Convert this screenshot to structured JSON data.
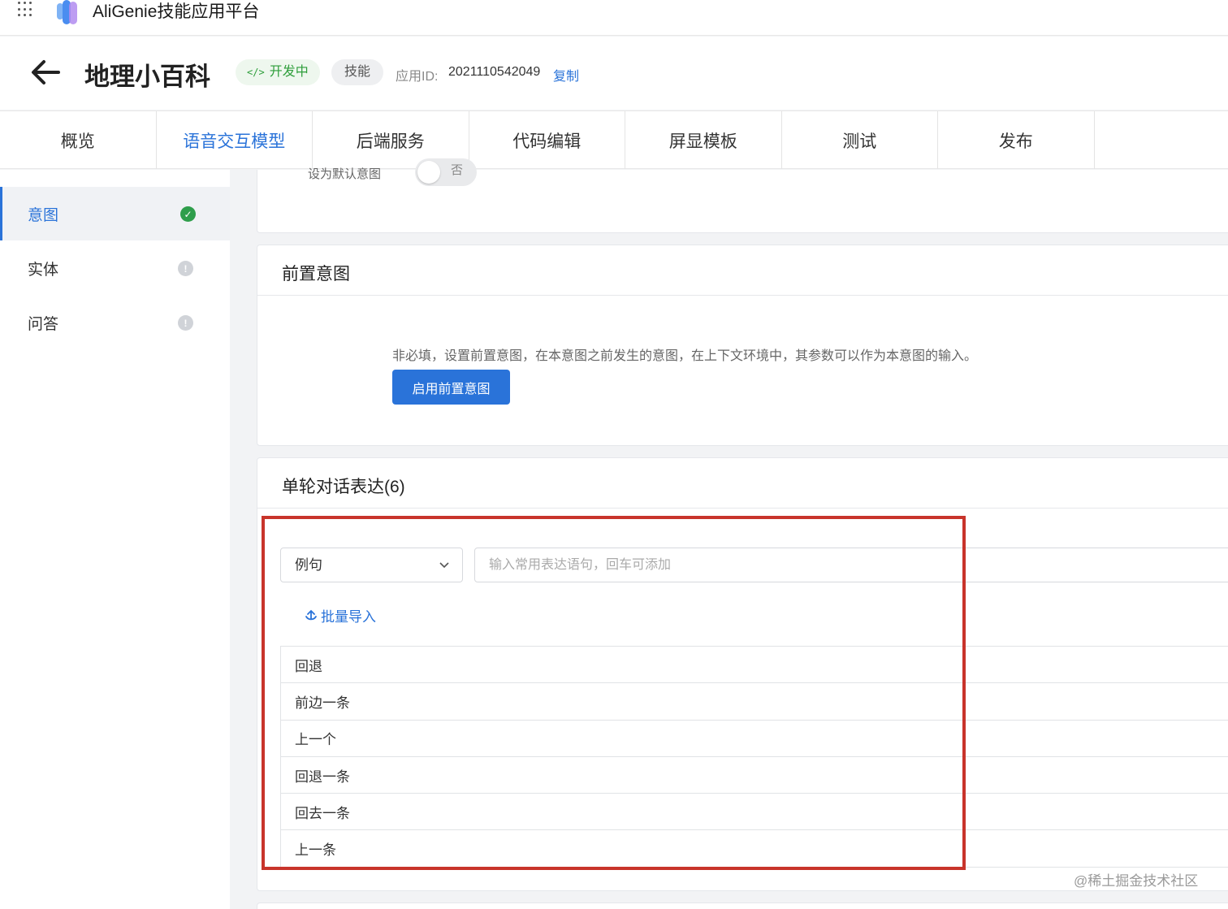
{
  "topbar": {
    "platform_title": "AliGenie技能应用平台"
  },
  "header": {
    "app_name": "地理小百科",
    "status_tag": "开发中",
    "type_tag": "技能",
    "app_id_label": "应用ID:",
    "app_id": "2021110542049",
    "copy_label": "复制"
  },
  "tabs": [
    {
      "label": "概览"
    },
    {
      "label": "语音交互模型",
      "active": true
    },
    {
      "label": "后端服务"
    },
    {
      "label": "代码编辑"
    },
    {
      "label": "屏显模板"
    },
    {
      "label": "测试"
    },
    {
      "label": "发布"
    }
  ],
  "sidebar": {
    "items": [
      {
        "label": "意图",
        "status": "ok"
      },
      {
        "label": "实体",
        "status": "warn"
      },
      {
        "label": "问答",
        "status": "warn"
      }
    ]
  },
  "default_intent": {
    "label": "设为默认意图",
    "toggle_text": "否"
  },
  "pre_intent": {
    "title": "前置意图",
    "description": "非必填，设置前置意图，在本意图之前发生的意图，在上下文环境中，其参数可以作为本意图的输入。",
    "button_label": "启用前置意图"
  },
  "expressions": {
    "title": "单轮对话表达(6)",
    "select_value": "例句",
    "input_placeholder": "输入常用表达语句，回车可添加",
    "import_label": "批量导入",
    "items": [
      "回退",
      "前边一条",
      "上一个",
      "回退一条",
      "回去一条",
      "上一条"
    ]
  },
  "watermark": "@稀土掘金技术社区",
  "colors": {
    "accent": "#2a73d9",
    "success": "#2e9e4b",
    "highlight": "#c8342b"
  }
}
